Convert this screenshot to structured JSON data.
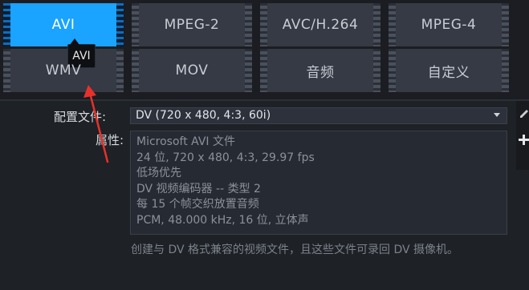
{
  "formats": {
    "row1": [
      "AVI",
      "MPEG-2",
      "AVC/H.264",
      "MPEG-4"
    ],
    "row2": [
      "WMV",
      "MOV",
      "音频",
      "自定义"
    ],
    "active": "AVI"
  },
  "tooltip": {
    "text": "AVI"
  },
  "settings": {
    "profile_label": "配置文件:",
    "profile_value": "DV (720 x 480, 4:3, 60i)",
    "properties_label": "属性:",
    "properties": [
      "Microsoft AVI 文件",
      "24 位, 720 x 480, 4:3, 29.97 fps",
      "低场优先",
      "DV 视频编码器 -- 类型 2",
      "每 15 个帧交织放置音频",
      "PCM, 48.000 kHz, 16 位, 立体声"
    ],
    "description": "创建与 DV 格式兼容的视频文件，且这些文件可录回 DV 摄像机。"
  },
  "colors": {
    "active_tile": "#1aa3ff",
    "tile": "#353a45",
    "background": "#1e2126",
    "annotation_arrow": "#e8312a"
  },
  "icons": [
    "edit-icon",
    "plus-icon"
  ]
}
